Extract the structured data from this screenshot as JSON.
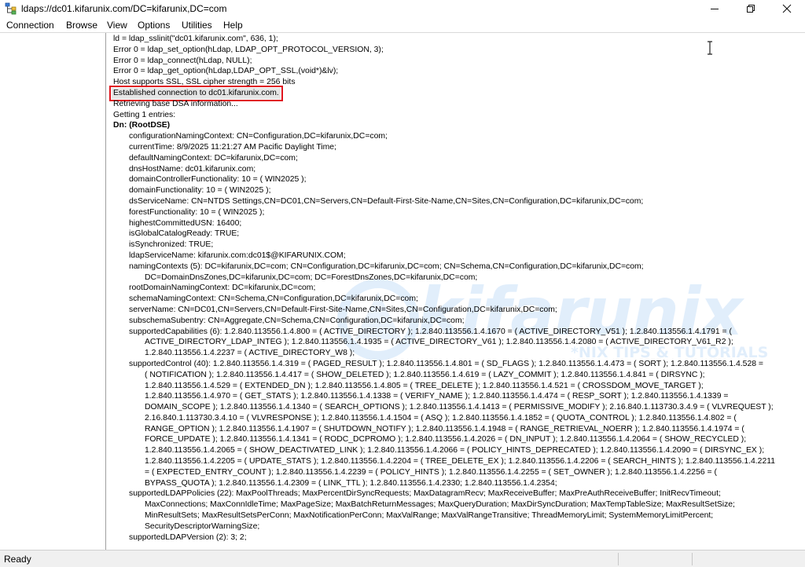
{
  "window": {
    "title": "ldaps://dc01.kifarunix.com/DC=kifarunix,DC=com",
    "app_icon": "ldp-tree-icon",
    "controls": [
      "minimize-icon",
      "maximize-icon",
      "close-icon"
    ]
  },
  "menu": {
    "items": [
      "Connection",
      "Browse",
      "View",
      "Options",
      "Utilities",
      "Help"
    ]
  },
  "watermark": {
    "brand": "kifarunix",
    "tagline": "*NIX TIPS & TUTORIALS"
  },
  "colors": {
    "highlight_border": "#e0141e",
    "highlight_fill": "#e6e6e6",
    "watermark": "#4696e6"
  },
  "output": {
    "lines": [
      {
        "indent": 0,
        "text": "ld = ldap_sslinit(\"dc01.kifarunix.com\", 636, 1);"
      },
      {
        "indent": 0,
        "text": "Error 0 = ldap_set_option(hLdap, LDAP_OPT_PROTOCOL_VERSION, 3);"
      },
      {
        "indent": 0,
        "text": "Error 0 = ldap_connect(hLdap, NULL);"
      },
      {
        "indent": 0,
        "text": "Error 0 = ldap_get_option(hLdap,LDAP_OPT_SSL,(void*)&lv);"
      },
      {
        "indent": 0,
        "text": "Host supports SSL, SSL cipher strength = 256 bits"
      },
      {
        "indent": 0,
        "text": "Established connection to dc01.kifarunix.com.",
        "highlight": true
      },
      {
        "indent": 0,
        "text": "Retrieving base DSA information..."
      },
      {
        "indent": 0,
        "text": "Getting 1 entries:"
      },
      {
        "indent": 0,
        "text": "Dn: (RootDSE)",
        "bold": true
      },
      {
        "indent": 1,
        "text": "configurationNamingContext: CN=Configuration,DC=kifarunix,DC=com;"
      },
      {
        "indent": 1,
        "text": "currentTime: 8/9/2025 11:21:27 AM Pacific Daylight Time;"
      },
      {
        "indent": 1,
        "text": "defaultNamingContext: DC=kifarunix,DC=com;"
      },
      {
        "indent": 1,
        "text": "dnsHostName: dc01.kifarunix.com;"
      },
      {
        "indent": 1,
        "text": "domainControllerFunctionality: 10 = ( WIN2025 );"
      },
      {
        "indent": 1,
        "text": "domainFunctionality: 10 = ( WIN2025 );"
      },
      {
        "indent": 1,
        "text": "dsServiceName: CN=NTDS Settings,CN=DC01,CN=Servers,CN=Default-First-Site-Name,CN=Sites,CN=Configuration,DC=kifarunix,DC=com;"
      },
      {
        "indent": 1,
        "text": "forestFunctionality: 10 = ( WIN2025 );"
      },
      {
        "indent": 1,
        "text": "highestCommittedUSN: 16400;"
      },
      {
        "indent": 1,
        "text": "isGlobalCatalogReady: TRUE;"
      },
      {
        "indent": 1,
        "text": "isSynchronized: TRUE;"
      },
      {
        "indent": 1,
        "text": "ldapServiceName: kifarunix.com:dc01$@KIFARUNIX.COM;"
      },
      {
        "indent": 1,
        "text": "namingContexts (5): DC=kifarunix,DC=com; CN=Configuration,DC=kifarunix,DC=com; CN=Schema,CN=Configuration,DC=kifarunix,DC=com;"
      },
      {
        "indent": 2,
        "text": "DC=DomainDnsZones,DC=kifarunix,DC=com; DC=ForestDnsZones,DC=kifarunix,DC=com;"
      },
      {
        "indent": 1,
        "text": "rootDomainNamingContext: DC=kifarunix,DC=com;"
      },
      {
        "indent": 1,
        "text": "schemaNamingContext: CN=Schema,CN=Configuration,DC=kifarunix,DC=com;"
      },
      {
        "indent": 1,
        "text": "serverName: CN=DC01,CN=Servers,CN=Default-First-Site-Name,CN=Sites,CN=Configuration,DC=kifarunix,DC=com;"
      },
      {
        "indent": 1,
        "text": "subschemaSubentry: CN=Aggregate,CN=Schema,CN=Configuration,DC=kifarunix,DC=com;"
      },
      {
        "indent": 1,
        "text": "supportedCapabilities (6): 1.2.840.113556.1.4.800 = ( ACTIVE_DIRECTORY ); 1.2.840.113556.1.4.1670 = ( ACTIVE_DIRECTORY_V51 ); 1.2.840.113556.1.4.1791 = ("
      },
      {
        "indent": 2,
        "text": "ACTIVE_DIRECTORY_LDAP_INTEG ); 1.2.840.113556.1.4.1935 = ( ACTIVE_DIRECTORY_V61 ); 1.2.840.113556.1.4.2080 = ( ACTIVE_DIRECTORY_V61_R2 );"
      },
      {
        "indent": 2,
        "text": "1.2.840.113556.1.4.2237 = ( ACTIVE_DIRECTORY_W8 );"
      },
      {
        "indent": 1,
        "text": "supportedControl (40): 1.2.840.113556.1.4.319 = ( PAGED_RESULT ); 1.2.840.113556.1.4.801 = ( SD_FLAGS ); 1.2.840.113556.1.4.473 = ( SORT ); 1.2.840.113556.1.4.528 ="
      },
      {
        "indent": 2,
        "text": "( NOTIFICATION ); 1.2.840.113556.1.4.417 = ( SHOW_DELETED ); 1.2.840.113556.1.4.619 = ( LAZY_COMMIT ); 1.2.840.113556.1.4.841 = ( DIRSYNC );"
      },
      {
        "indent": 2,
        "text": "1.2.840.113556.1.4.529 = ( EXTENDED_DN ); 1.2.840.113556.1.4.805 = ( TREE_DELETE ); 1.2.840.113556.1.4.521 = ( CROSSDOM_MOVE_TARGET );"
      },
      {
        "indent": 2,
        "text": "1.2.840.113556.1.4.970 = ( GET_STATS ); 1.2.840.113556.1.4.1338 = ( VERIFY_NAME ); 1.2.840.113556.1.4.474 = ( RESP_SORT ); 1.2.840.113556.1.4.1339 ="
      },
      {
        "indent": 2,
        "text": "DOMAIN_SCOPE ); 1.2.840.113556.1.4.1340 = ( SEARCH_OPTIONS ); 1.2.840.113556.1.4.1413 = ( PERMISSIVE_MODIFY ); 2.16.840.1.113730.3.4.9 = ( VLVREQUEST );"
      },
      {
        "indent": 2,
        "text": "2.16.840.1.113730.3.4.10 = ( VLVRESPONSE ); 1.2.840.113556.1.4.1504 = ( ASQ ); 1.2.840.113556.1.4.1852 = ( QUOTA_CONTROL ); 1.2.840.113556.1.4.802 = ("
      },
      {
        "indent": 2,
        "text": "RANGE_OPTION ); 1.2.840.113556.1.4.1907 = ( SHUTDOWN_NOTIFY ); 1.2.840.113556.1.4.1948 = ( RANGE_RETRIEVAL_NOERR ); 1.2.840.113556.1.4.1974 = ("
      },
      {
        "indent": 2,
        "text": "FORCE_UPDATE ); 1.2.840.113556.1.4.1341 = ( RODC_DCPROMO ); 1.2.840.113556.1.4.2026 = ( DN_INPUT ); 1.2.840.113556.1.4.2064 = ( SHOW_RECYCLED );"
      },
      {
        "indent": 2,
        "text": "1.2.840.113556.1.4.2065 = ( SHOW_DEACTIVATED_LINK ); 1.2.840.113556.1.4.2066 = ( POLICY_HINTS_DEPRECATED ); 1.2.840.113556.1.4.2090 = ( DIRSYNC_EX );"
      },
      {
        "indent": 2,
        "text": "1.2.840.113556.1.4.2205 = ( UPDATE_STATS ); 1.2.840.113556.1.4.2204 = ( TREE_DELETE_EX ); 1.2.840.113556.1.4.2206 = ( SEARCH_HINTS ); 1.2.840.113556.1.4.2211"
      },
      {
        "indent": 2,
        "text": "= ( EXPECTED_ENTRY_COUNT ); 1.2.840.113556.1.4.2239 = ( POLICY_HINTS ); 1.2.840.113556.1.4.2255 = ( SET_OWNER ); 1.2.840.113556.1.4.2256 = ("
      },
      {
        "indent": 2,
        "text": "BYPASS_QUOTA ); 1.2.840.113556.1.4.2309 = ( LINK_TTL ); 1.2.840.113556.1.4.2330; 1.2.840.113556.1.4.2354;"
      },
      {
        "indent": 1,
        "text": "supportedLDAPPolicies (22): MaxPoolThreads; MaxPercentDirSyncRequests; MaxDatagramRecv; MaxReceiveBuffer; MaxPreAuthReceiveBuffer; InitRecvTimeout;"
      },
      {
        "indent": 2,
        "text": "MaxConnections; MaxConnIdleTime; MaxPageSize; MaxBatchReturnMessages; MaxQueryDuration; MaxDirSyncDuration; MaxTempTableSize; MaxResultSetSize;"
      },
      {
        "indent": 2,
        "text": "MinResultSets; MaxResultSetsPerConn; MaxNotificationPerConn; MaxValRange; MaxValRangeTransitive; ThreadMemoryLimit; SystemMemoryLimitPercent;"
      },
      {
        "indent": 2,
        "text": "SecurityDescriptorWarningSize;"
      },
      {
        "indent": 1,
        "text": "supportedLDAPVersion (2): 3; 2;"
      }
    ]
  },
  "status": {
    "text": "Ready"
  }
}
